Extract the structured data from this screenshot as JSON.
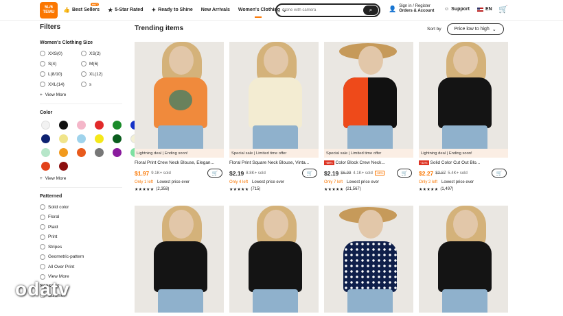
{
  "header": {
    "logo_top": "5L/6",
    "logo_bottom": "TEMU",
    "nav": [
      {
        "label": "Best Sellers",
        "icon": "thumbs-up-icon"
      },
      {
        "label": "5-Star Rated",
        "icon": "star-icon"
      },
      {
        "label": "Ready to Shine",
        "icon": "sparkle-icon"
      },
      {
        "label": "New Arrivals",
        "icon": ""
      },
      {
        "label": "Women's Clothing",
        "icon": "chevron-down-icon"
      }
    ],
    "hot_badge": "HOT",
    "search_value": "drone with camera",
    "account_line1": "Sign in / Register",
    "account_line2": "Orders & Account",
    "support": "Support",
    "language": "EN"
  },
  "sidebar": {
    "title": "Filters",
    "size_title": "Women's Clothing Size",
    "sizes": [
      "XXS(0)",
      "XS(2)",
      "S(4)",
      "M(6)",
      "L(8/10)",
      "XL(12)",
      "XXL(14)",
      "s"
    ],
    "view_more": "View More",
    "color_title": "Color",
    "colors": [
      "#f2f2f2",
      "#111111",
      "#f4b6c9",
      "#e12a2a",
      "#1a8b2a",
      "#1633c7",
      "#0d2170",
      "#f0e48a",
      "#9fd3ec",
      "#f5e81a",
      "#0b5d1e",
      "#f3f0d4",
      "#b6e6c9",
      "#f29a1d",
      "#e85a1c",
      "#777777",
      "#8a1c9e",
      "#7de0a1",
      "#e2421a",
      "#8c0f0f"
    ],
    "view_more2": "View More",
    "patterned_title": "Patterned",
    "patterns": [
      "Solid color",
      "Floral",
      "Plaid",
      "Print",
      "Stripes",
      "Geometric-pattern",
      "All Over Print",
      "View More"
    ],
    "seasons_title": "Seasons",
    "seasons": [
      "Summer"
    ]
  },
  "watermark": "odatv",
  "main": {
    "title": "Trending items",
    "sort_label": "Sort by",
    "sort_value": "Price low to high"
  },
  "products": [
    {
      "deal": "Lightning deal | Ending soon!",
      "badge": "",
      "title": "Floral Print Crew Neck Blouse, Elegan...",
      "price": "$1.97",
      "orig": "",
      "pct": "",
      "sold": "9.1K+ sold",
      "stock": "Only 1 left",
      "lowest": "Lowest price ever",
      "stars": "★★★★★",
      "reviews": "(2,358)",
      "top_color": "#f08a3c",
      "accent": "#2f7d6a"
    },
    {
      "deal": "Special sale | Limited time offer",
      "badge": "",
      "title": "Floral Print Square Neck Blouse, Vinta...",
      "price": "$2.19",
      "orig": "",
      "pct": "",
      "sold": "8.8K+ sold",
      "stock": "Only 4 left",
      "lowest": "Lowest price ever",
      "stars": "★★★★★",
      "reviews": "(715)",
      "top_color": "#f3ecd2",
      "accent": "#d8b640"
    },
    {
      "deal": "Special sale | Limited time offer",
      "badge": "-68%",
      "title": "Color Block Crew Neck...",
      "price": "$2.19",
      "orig": "$6.99",
      "pct": "-68%",
      "sold": "4.1K+ sold",
      "stock": "Only 7 left",
      "lowest": "Lowest price ever",
      "stars": "★★★★★",
      "reviews": "(21,567)",
      "top_color": "#111111",
      "accent": "#ee4a1a"
    },
    {
      "deal": "Lightning deal | Ending soon!",
      "badge": "-41%",
      "title": "Solid Color Cut Out Blo...",
      "price": "$2.27",
      "orig": "$3.87",
      "pct": "",
      "sold": "5.4K+ sold",
      "stock": "Only 2 left",
      "lowest": "Lowest price ever",
      "stars": "★★★★★",
      "reviews": "(1,497)",
      "top_color": "#141414",
      "accent": "#141414"
    },
    {
      "top_color": "#141414",
      "accent": "#141414"
    },
    {
      "top_color": "#141414",
      "accent": "#141414"
    },
    {
      "top_color": "#0f1f4a",
      "accent": "#ffffff"
    },
    {
      "top_color": "#141414",
      "accent": "#141414"
    }
  ]
}
